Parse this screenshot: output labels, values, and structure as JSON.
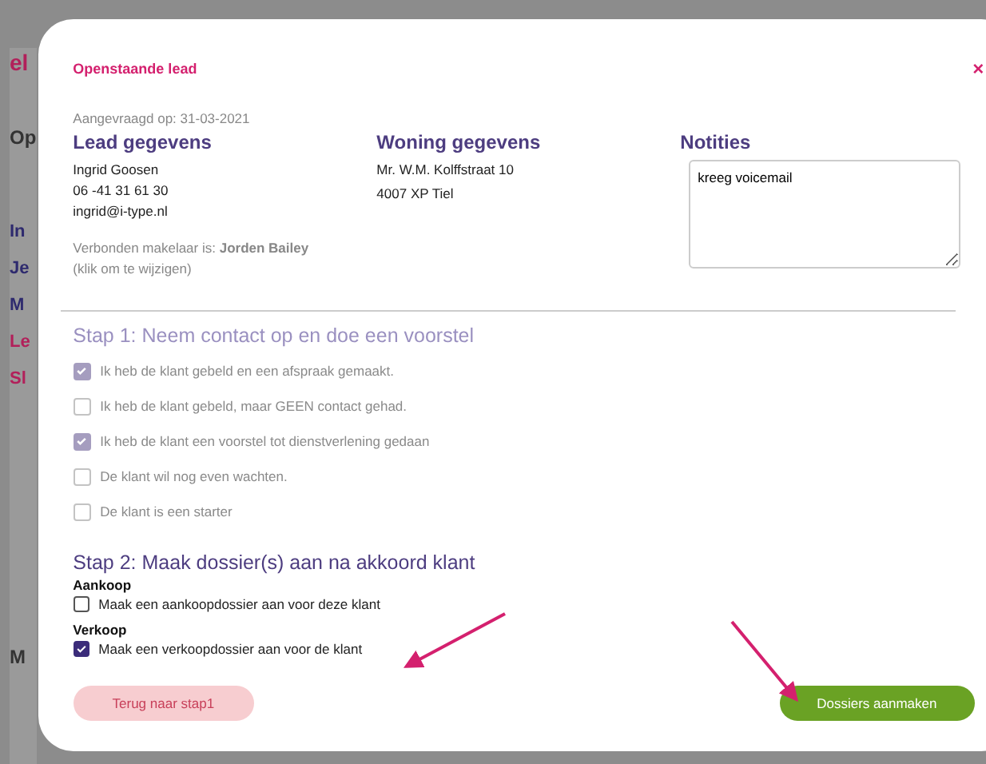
{
  "background_page": {
    "fragments": [
      {
        "text": "el",
        "kind": "logo"
      },
      {
        "text": "Op",
        "kind": "heading"
      },
      {
        "text": "In",
        "kind": "link"
      },
      {
        "text": "Je",
        "kind": "link"
      },
      {
        "text": "M",
        "kind": "link"
      },
      {
        "text": "Le",
        "kind": "alert"
      },
      {
        "text": "Sl",
        "kind": "alert"
      },
      {
        "text": "M",
        "kind": "heading"
      }
    ]
  },
  "modal": {
    "title": "Openstaande lead",
    "close": "×",
    "requested": "Aangevraagd op: 31-03-2021",
    "lead": {
      "heading": "Lead gegevens",
      "lines": [
        "Ingrid Goosen",
        "06 -41 31 61 30",
        "ingrid@i-type.nl"
      ],
      "agent": "Verbonden makelaar is: **Jorden Bailey**",
      "agent_hint": "(klik om te wijzigen)"
    },
    "house": {
      "heading": "Woning gegevens",
      "lines": [
        "Mr. W.M. Kolffstraat 10",
        "4007 XP Tiel"
      ]
    },
    "notes": {
      "heading": "Notities",
      "value": "kreeg voicemail"
    },
    "step1": {
      "heading": "Stap 1: Neem contact op en doe een voorstel",
      "disabled": true,
      "options": [
        {
          "label": "Ik heb de klant gebeld en een afspraak gemaakt.",
          "checked": true
        },
        {
          "label": "Ik heb de klant gebeld, maar GEEN contact gehad.",
          "checked": false
        },
        {
          "label": "Ik heb de klant een voorstel tot dienstverlening gedaan",
          "checked": true
        },
        {
          "label": "De klant wil nog even wachten.",
          "checked": false
        },
        {
          "label": "De klant is een starter",
          "checked": false
        }
      ]
    },
    "step2": {
      "heading": "Stap 2: Maak dossier(s) aan na akkoord klant",
      "groups": [
        {
          "title": "Aankoop",
          "label": "Maak een aankoopdossier aan voor deze klant",
          "checked": false
        },
        {
          "title": "Verkoop",
          "label": "Maak een verkoopdossier aan voor de klant",
          "checked": true
        }
      ]
    },
    "buttons": [
      {
        "label": "Terug naar stap1",
        "kind": "secondary"
      },
      {
        "label": "Dossiers aanmaken",
        "kind": "primary"
      }
    ]
  }
}
